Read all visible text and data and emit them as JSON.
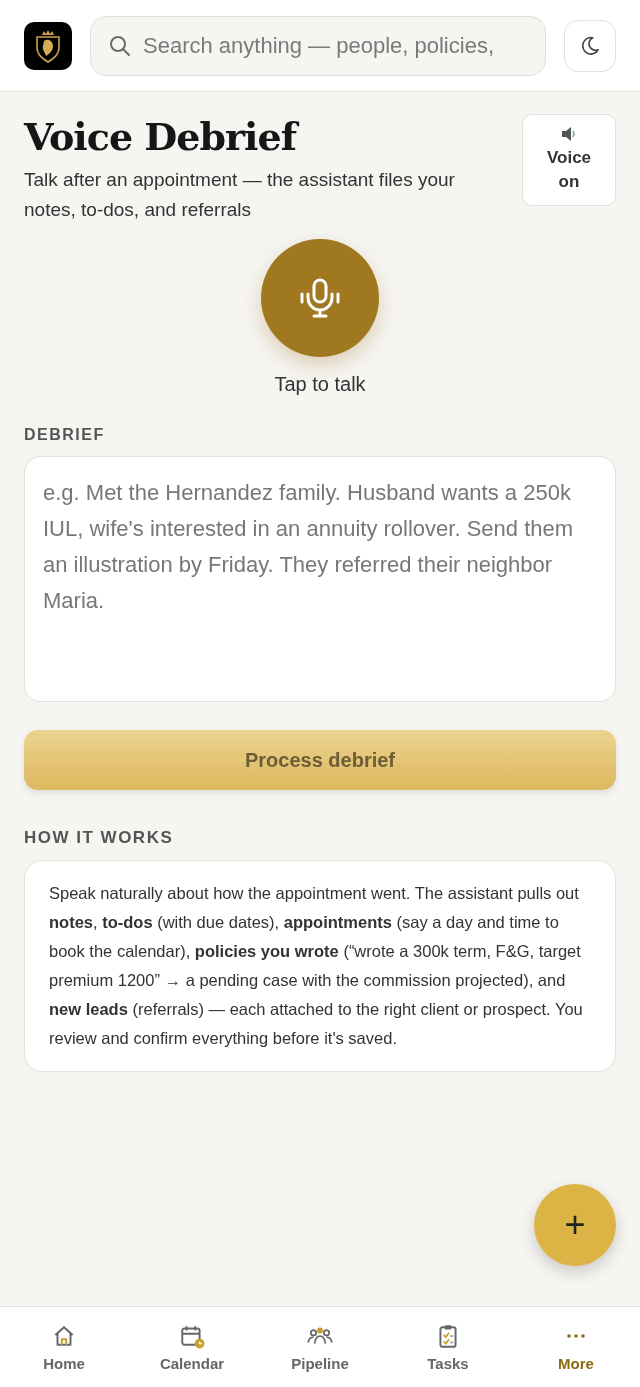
{
  "header": {
    "search": {
      "placeholder": "Search anything — people, policies,"
    }
  },
  "page": {
    "title": "Voice Debrief",
    "subtitle": "Talk after an appointment — the assistant files your notes, to-dos, and referrals",
    "voice_toggle": {
      "label": "Voice on",
      "on": true
    }
  },
  "record": {
    "label": "Tap to talk"
  },
  "debrief": {
    "heading": "DEBRIEF",
    "placeholder": "e.g. Met the Hernandez family. Husband wants a 250k IUL, wife's interested in an annuity rollover. Send them an illustration by Friday. They referred their neighbor Maria.",
    "button": "Process debrief"
  },
  "how_it_works": {
    "heading": "HOW IT WORKS",
    "text": "Speak naturally about how the appointment went. The assistant pulls out **notes**, **to-dos** (with due dates), **appointments** (say a day and time to book the calendar), **policies you wrote** (“wrote a 300k term, F&G, target premium 1200” → a pending case with the commission projected), and **new leads** (referrals) — each attached to the right client or prospect. You review and confirm everything before it's saved."
  },
  "fab": {
    "label": "+"
  },
  "bottom_nav": [
    {
      "label": "Home",
      "selected": false
    },
    {
      "label": "Calendar",
      "selected": false
    },
    {
      "label": "Pipeline",
      "selected": false
    },
    {
      "label": "Tasks",
      "selected": false
    },
    {
      "label": "More",
      "selected": true
    }
  ]
}
